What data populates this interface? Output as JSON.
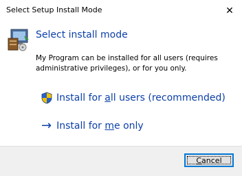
{
  "window": {
    "title": "Select Setup Install Mode",
    "close_glyph": "✕"
  },
  "header": {
    "heading": "Select install mode",
    "icon": "setup-computer-icon"
  },
  "description": "My Program can be installed for all users (requires administrative privileges), or for you only.",
  "options": {
    "all_users": {
      "pre": "Install for ",
      "accel": "a",
      "post": "ll users (recommended)",
      "icon": "uac-shield-icon"
    },
    "me_only": {
      "pre": "Install for ",
      "accel": "m",
      "post": "e only",
      "arrow": "→",
      "icon": "arrow-right-icon"
    }
  },
  "footer": {
    "cancel_pre": "",
    "cancel_accel": "C",
    "cancel_post": "ancel"
  },
  "colors": {
    "link_blue": "#0b3fa8",
    "footer_bg": "#f0f0f0",
    "focus_border": "#0078d7"
  }
}
